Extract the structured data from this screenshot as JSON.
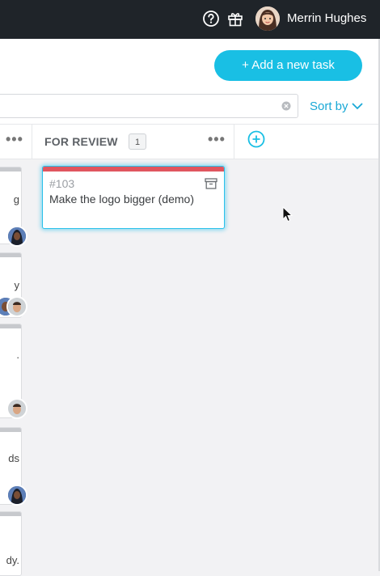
{
  "topbar": {
    "user_name": "Merrin Hughes",
    "icons": [
      "help-icon",
      "gift-icon"
    ]
  },
  "header": {
    "add_task_label": "+ Add a new task",
    "search_value": "",
    "sort_label": "Sort by"
  },
  "columns": [
    {
      "title": "FOR REVIEW",
      "count": "1",
      "cards": [
        {
          "id": "#103",
          "title": "Make the logo bigger (demo)",
          "strip_color": "#e0565f"
        }
      ]
    }
  ],
  "left_column_fragments": [
    "g",
    "y",
    ".",
    "ds",
    "dy."
  ],
  "colors": {
    "accent": "#19bfe4",
    "topbar": "#1f2429",
    "review_strip": "#e0565f"
  }
}
